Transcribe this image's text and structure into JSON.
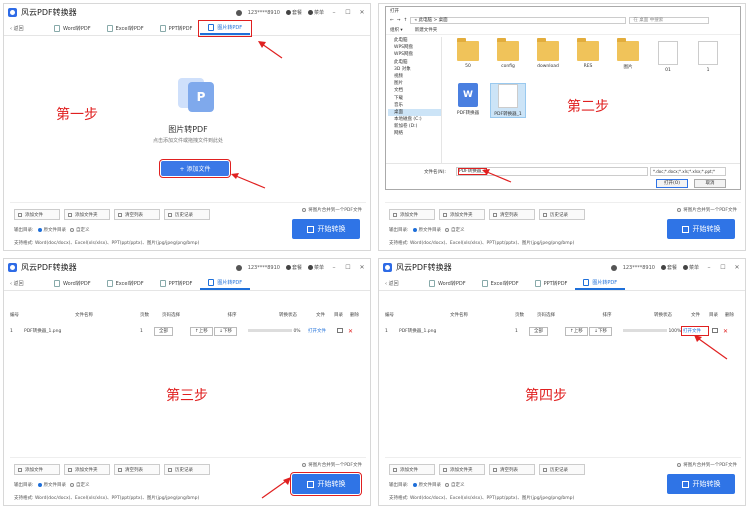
{
  "app": {
    "title": "风云PDF转换器",
    "user": "123****8910",
    "vip": "套餐",
    "menu": "菜单",
    "back": "返回",
    "tabs": [
      "Word转PDF",
      "Excel转PDF",
      "PPT转PDF",
      "图片转PDF"
    ],
    "tool_buttons": [
      "添加文件",
      "添加文件夹",
      "清空列表",
      "历史记录"
    ],
    "merge_label": "将图片合并到一个PDF文件",
    "out_dir_label": "输出目录:",
    "out_dir_option1": "原文件目录",
    "out_dir_option2": "自定义",
    "formats_label": "支持格式:",
    "formats": "Word(doc/docx)、Excel(xls/xlsx)、PPT(ppt/pptx)、图片(jpg/jpeg/png/bmp)",
    "start": "开始转换"
  },
  "step1": {
    "label": "第一步",
    "hero_title": "图片转PDF",
    "hero_sub": "点击添加文件或拖拽文件到此处",
    "add_file": "+ 添加文件"
  },
  "step2": {
    "label": "第二步",
    "title": "打开",
    "address": "« 此电脑 > 桌面",
    "search": "在 桌面 中搜索",
    "organize": "组织 ▾",
    "new_folder": "新建文件夹",
    "tree": [
      "此电脑",
      "WPS网盘",
      "WPS网盘",
      "此电脑",
      "3D 对象",
      "视频",
      "图片",
      "文档",
      "下载",
      "音乐",
      "桌面",
      "本地磁盘 (C:)",
      "新加卷 (D:)",
      "网络"
    ],
    "files": [
      {
        "name": "50",
        "kind": "folder"
      },
      {
        "name": "config",
        "kind": "folder"
      },
      {
        "name": "download",
        "kind": "folder"
      },
      {
        "name": "RES",
        "kind": "folder"
      },
      {
        "name": "图片",
        "kind": "folder"
      },
      {
        "name": "01",
        "kind": "doc"
      },
      {
        "name": "1",
        "kind": "doc"
      },
      {
        "name": "PDF转换器",
        "kind": "wps"
      },
      {
        "name": "PDF转换器_1",
        "kind": "doc"
      }
    ],
    "filename_label": "文件名(N):",
    "filename_value": "PDF转换器_1",
    "filetype": "*.doc;*.docx;*.xls;*.xlsx;*.ppt;*",
    "open": "打开(O)",
    "cancel": "取消"
  },
  "table": {
    "headers": [
      "编号",
      "文件名称",
      "页数",
      "页码选择",
      "排序",
      "转换状态",
      "文件",
      "目录",
      "删除"
    ],
    "row": {
      "index": "1",
      "name": "PDF转换器_1.png",
      "pages": "1",
      "page_select": "全部",
      "up": "↑上移",
      "down": "↓下移",
      "open_file": "打开文件"
    }
  },
  "step3": {
    "label": "第三步",
    "progress_text": "0%",
    "progress": 0
  },
  "step4": {
    "label": "第四步",
    "progress_text": "100%",
    "progress": 1
  }
}
